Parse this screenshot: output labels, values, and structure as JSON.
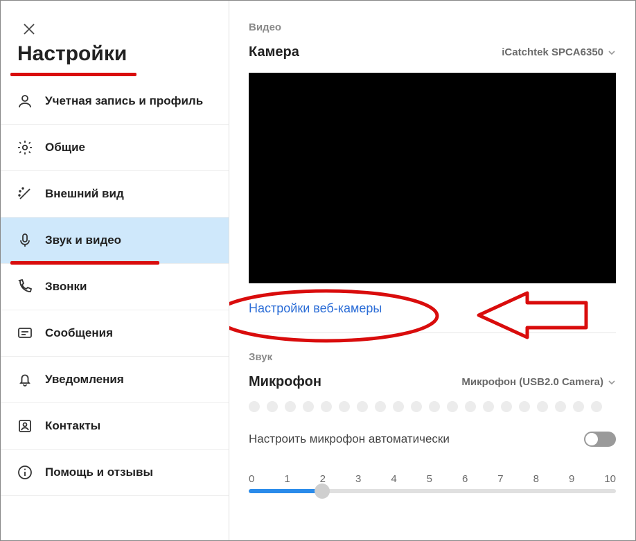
{
  "sidebar": {
    "title": "Настройки",
    "items": [
      {
        "label": "Учетная запись и профиль"
      },
      {
        "label": "Общие"
      },
      {
        "label": "Внешний вид"
      },
      {
        "label": "Звук и видео"
      },
      {
        "label": "Звонки"
      },
      {
        "label": "Сообщения"
      },
      {
        "label": "Уведомления"
      },
      {
        "label": "Контакты"
      },
      {
        "label": "Помощь и отзывы"
      }
    ]
  },
  "video": {
    "section_label": "Видео",
    "camera_label": "Камера",
    "camera_device": "iCatchtek SPCA6350",
    "webcam_settings_link": "Настройки веб-камеры"
  },
  "audio": {
    "section_label": "Звук",
    "mic_label": "Микрофон",
    "mic_device": "Микрофон (USB2.0 Camera)",
    "auto_adjust_label": "Настроить микрофон автоматически",
    "auto_adjust_on": false,
    "slider": {
      "min": 0,
      "max": 10,
      "value": 2,
      "ticks": [
        "0",
        "1",
        "2",
        "3",
        "4",
        "5",
        "6",
        "7",
        "8",
        "9",
        "10"
      ]
    }
  }
}
